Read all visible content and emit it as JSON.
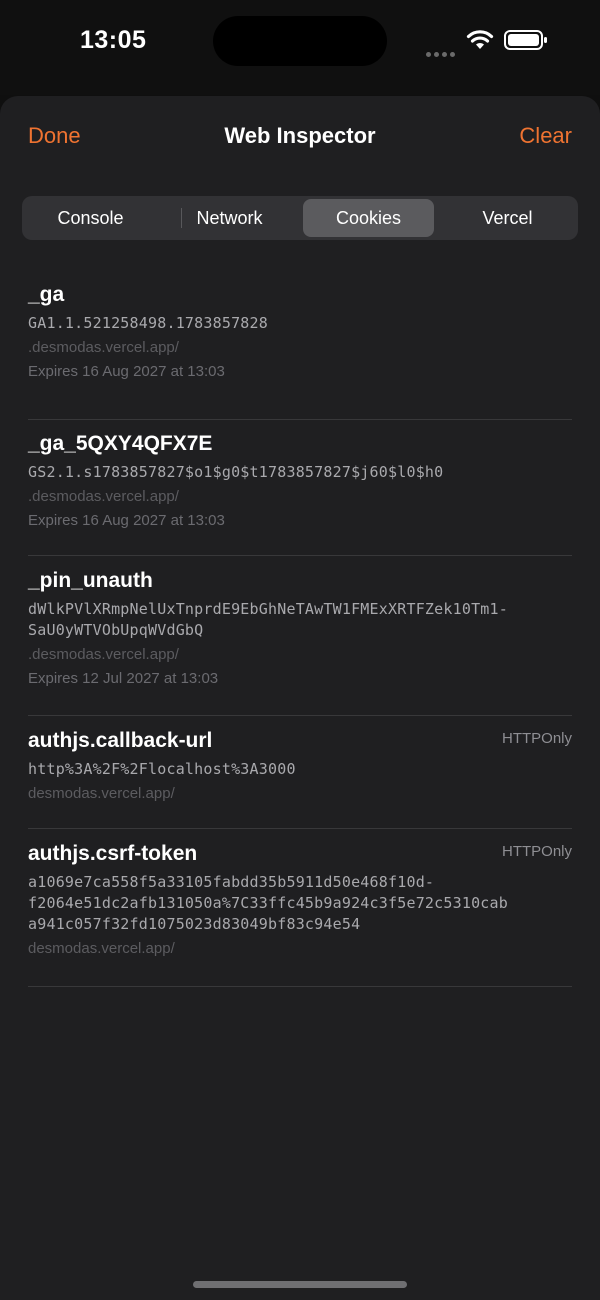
{
  "status_bar": {
    "time": "13:05"
  },
  "nav": {
    "done_label": "Done",
    "title": "Web Inspector",
    "clear_label": "Clear"
  },
  "tabs": [
    {
      "label": "Console"
    },
    {
      "label": "Network"
    },
    {
      "label": "Cookies",
      "selected": true
    },
    {
      "label": "Vercel"
    }
  ],
  "cookies": [
    {
      "name": "_ga",
      "value": "GA1.1.521258498.1783857828",
      "domain": ".desmodas.vercel.app/",
      "expires": "Expires 16 Aug 2027 at 13:03"
    },
    {
      "name": "_ga_5QXY4QFX7E",
      "value": "GS2.1.s1783857827$o1$g0$t1783857827$j60$l0$h0",
      "domain": ".desmodas.vercel.app/",
      "expires": "Expires 16 Aug 2027 at 13:03"
    },
    {
      "name": "_pin_unauth",
      "value_lines": [
        "dWlkPVlXRmpNelUxTnprdE9EbGhNeTAwTW1FMExXRTFZek10Tm1-",
        "SaU0yWTVObUpqWVdGbQ"
      ],
      "domain": ".desmodas.vercel.app/",
      "expires": "Expires 12 Jul 2027 at 13:03"
    },
    {
      "name": "authjs.callback-url",
      "flag": "HTTPOnly",
      "value": "http%3A%2F%2Flocalhost%3A3000",
      "domain": "desmodas.vercel.app/"
    },
    {
      "name": "authjs.csrf-token",
      "flag": "HTTPOnly",
      "value_lines": [
        "a1069e7ca558f5a33105fabdd35b5911d50e468f10d-",
        "f2064e51dc2afb131050a%7C33ffc45b9a924c3f5e72c5310cab",
        "a941c057f32fd1075023d83049bf83c94e54"
      ],
      "domain": "desmodas.vercel.app/"
    }
  ],
  "colors": {
    "accent": "#ef7331",
    "sheet_bg": "#1f1f21",
    "segment_selected": "#5b5b5e"
  }
}
